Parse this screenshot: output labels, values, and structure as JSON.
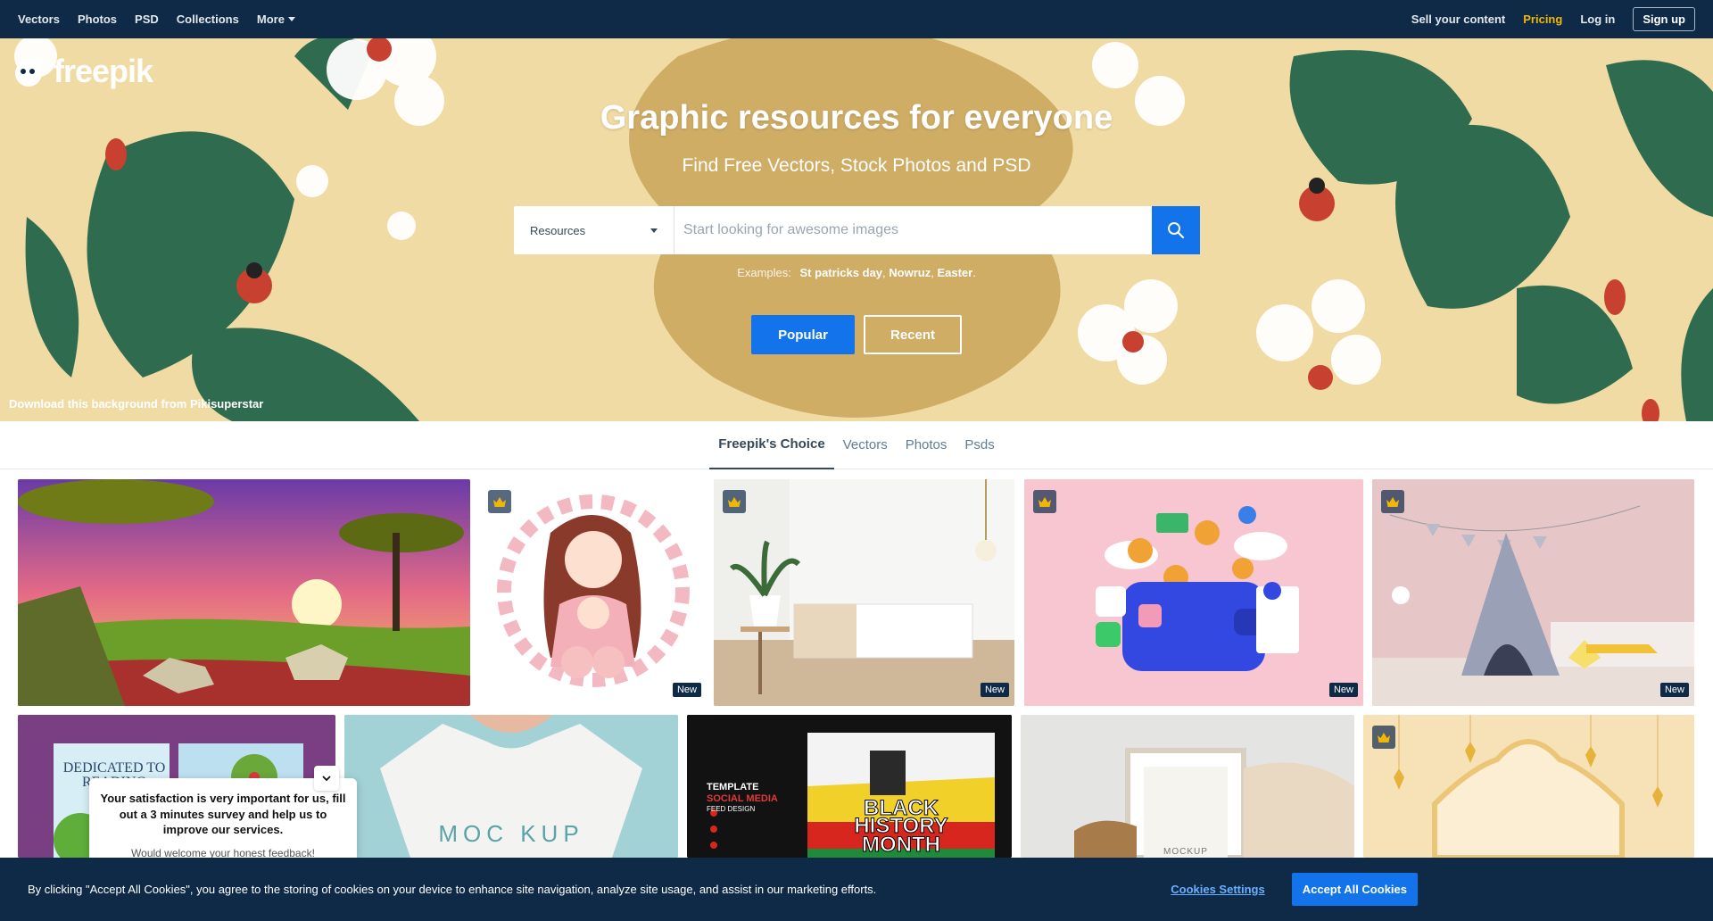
{
  "topnav": {
    "left": [
      "Vectors",
      "Photos",
      "PSD",
      "Collections"
    ],
    "more_label": "More",
    "sell": "Sell your content",
    "pricing": "Pricing",
    "login": "Log in",
    "signup": "Sign up"
  },
  "logo": {
    "text": "freepik"
  },
  "hero": {
    "title": "Graphic resources for everyone",
    "subtitle": "Find Free Vectors, Stock Photos and PSD",
    "search_select": "Resources",
    "search_placeholder": "Start looking for awesome images",
    "examples_label": "Examples:",
    "examples": [
      "St patricks day",
      "Nowruz",
      "Easter"
    ],
    "popular": "Popular",
    "recent": "Recent",
    "credit": "Download this background from Pikisuperstar"
  },
  "tabs": [
    "Freepik's Choice",
    "Vectors",
    "Photos",
    "Psds"
  ],
  "active_tab": "Freepik's Choice",
  "new_label": "New",
  "tiles_row2": {
    "book": "DEDICATED TO READING",
    "shirt": "MOC KUP",
    "social_1": "TEMPLATE",
    "social_2": "SOCIAL MEDIA",
    "social_3": "FEED DESIGN",
    "bhm_1": "BLACK",
    "bhm_2": "HISTORY",
    "bhm_3": "MONTH",
    "frame": "MOCKUP"
  },
  "survey": {
    "question": "Your satisfaction is very important for us, fill out a 3 minutes survey and help us to improve our services.",
    "sub": "Would welcome your honest feedback!"
  },
  "cookie": {
    "text": "By clicking \"Accept All Cookies\", you agree to the storing of cookies on your device to enhance site navigation, analyze site usage, and assist in our marketing efforts.",
    "settings": "Cookies Settings",
    "accept": "Accept All Cookies"
  },
  "colors": {
    "navy": "#0e2a47",
    "blue": "#1273eb",
    "pricing": "#f2b705"
  }
}
